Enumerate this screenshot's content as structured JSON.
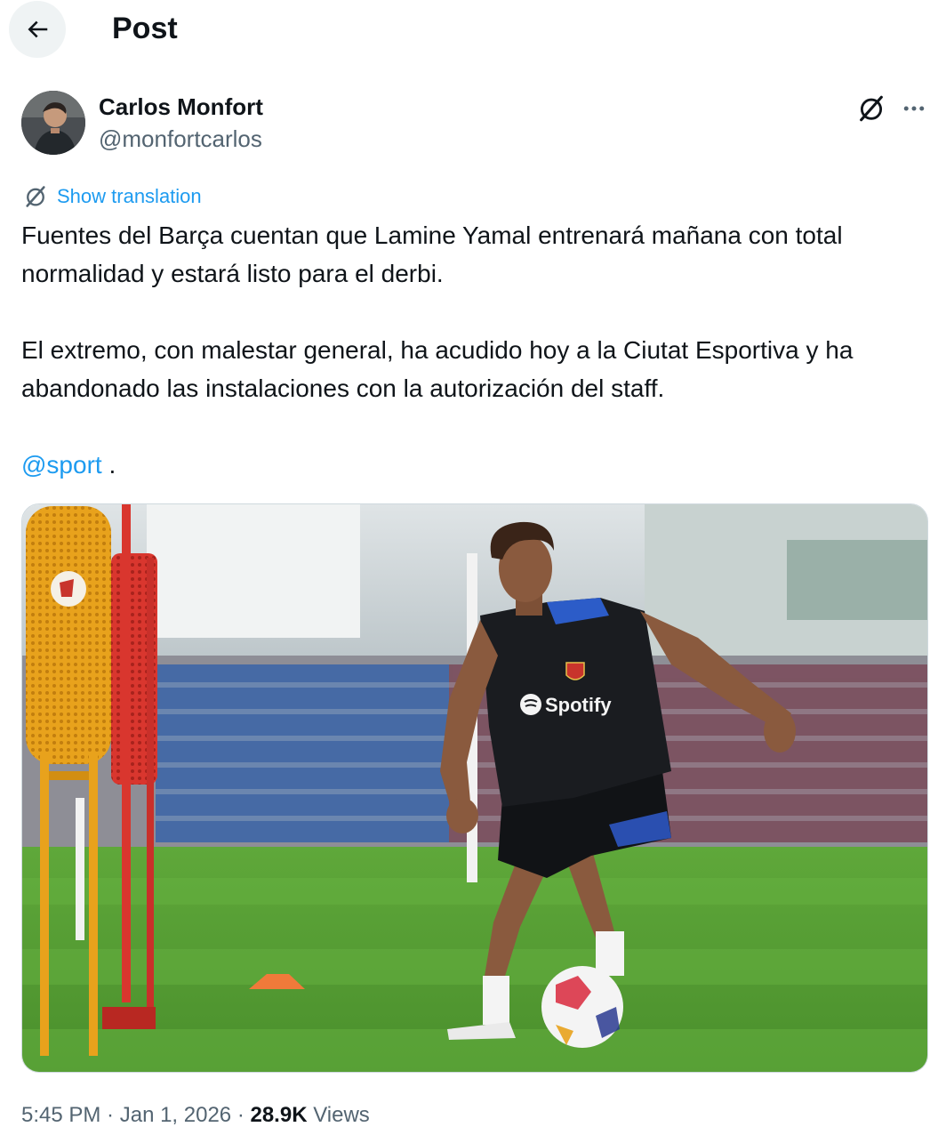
{
  "header": {
    "title": "Post"
  },
  "author": {
    "name": "Carlos Monfort",
    "handle": "@monfortcarlos"
  },
  "translation": {
    "label": "Show translation"
  },
  "post": {
    "paragraph1": "Fuentes del Barça cuentan que Lamine Yamal entrenará mañana con total normalidad y estará listo para el derbi.",
    "paragraph2": "El extremo, con malestar general, ha acudido hoy a la Ciutat Esportiva y ha abandonado las instalaciones con la autorización del staff.",
    "mention": "@sport",
    "mention_suffix": " ."
  },
  "media": {
    "shirt_sponsor": "Spotify"
  },
  "meta": {
    "time": "5:45 PM",
    "separator1": " · ",
    "date": "Jan 1, 2026",
    "separator2": " · ",
    "views_count": "28.9K",
    "views_label": " Views"
  },
  "colors": {
    "accent": "#1d9bf0",
    "text_primary": "#0f1419",
    "text_secondary": "#536471"
  },
  "icons": {
    "back": "arrow-left-icon",
    "grok": "grok-icon",
    "more": "more-horizontal-icon",
    "translate": "translate-icon"
  }
}
